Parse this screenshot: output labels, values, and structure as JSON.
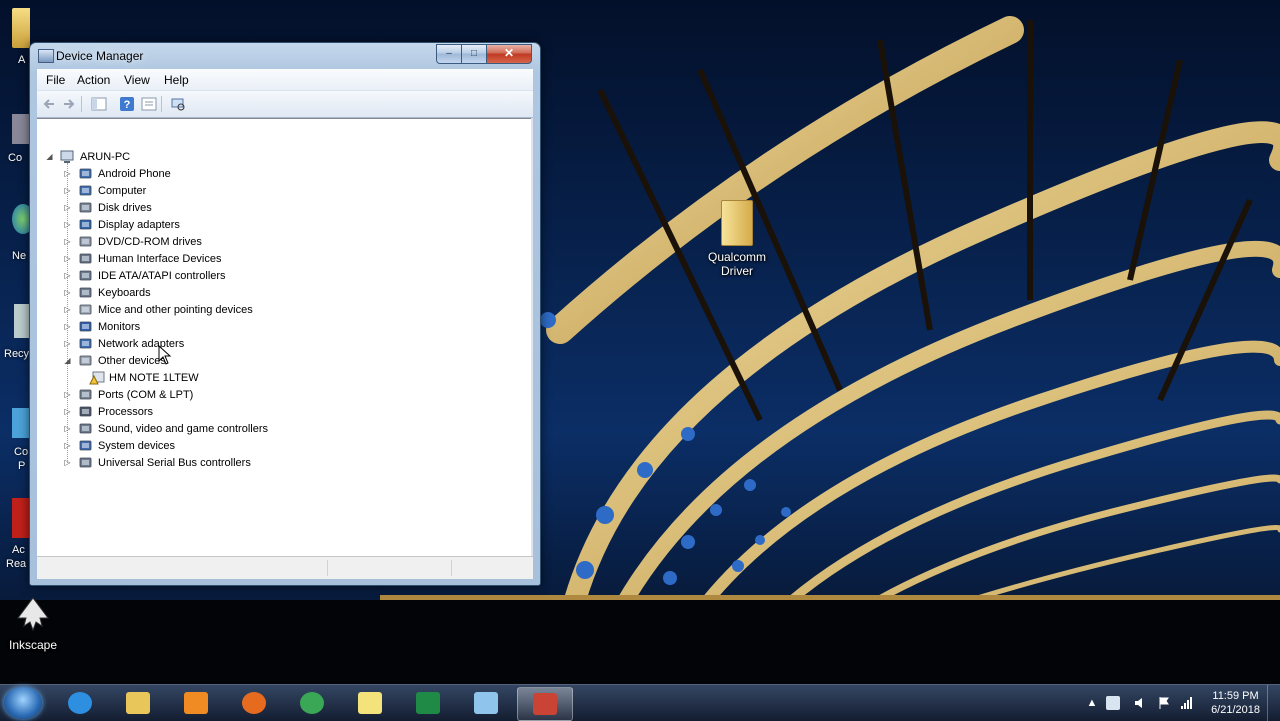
{
  "window": {
    "title": "Device Manager",
    "controls": {
      "minimize": "–",
      "maximize": "□",
      "close": "✕"
    }
  },
  "menu": {
    "file": "File",
    "action": "Action",
    "view": "View",
    "help": "Help"
  },
  "toolbar": {
    "icons": [
      "back-arrow-icon",
      "forward-arrow-icon",
      "show-hide-console-tree-icon",
      "help-icon",
      "properties-icon",
      "scan-hardware-icon"
    ]
  },
  "tree": {
    "root": "ARUN-PC",
    "items": [
      {
        "label": "Android Phone",
        "icon": "android-device-icon"
      },
      {
        "label": "Computer",
        "icon": "computer-icon"
      },
      {
        "label": "Disk drives",
        "icon": "disk-drive-icon"
      },
      {
        "label": "Display adapters",
        "icon": "display-adapter-icon"
      },
      {
        "label": "DVD/CD-ROM drives",
        "icon": "dvd-drive-icon"
      },
      {
        "label": "Human Interface Devices",
        "icon": "hid-icon"
      },
      {
        "label": "IDE ATA/ATAPI controllers",
        "icon": "ide-controller-icon"
      },
      {
        "label": "Keyboards",
        "icon": "keyboard-icon"
      },
      {
        "label": "Mice and other pointing devices",
        "icon": "mouse-icon"
      },
      {
        "label": "Monitors",
        "icon": "monitor-icon"
      },
      {
        "label": "Network adapters",
        "icon": "network-adapter-icon"
      },
      {
        "label": "Other devices",
        "icon": "other-devices-icon",
        "expanded": true
      },
      {
        "label": "HM NOTE 1LTEW",
        "icon": "warning-device-icon",
        "child": true
      },
      {
        "label": "Ports (COM & LPT)",
        "icon": "port-icon"
      },
      {
        "label": "Processors",
        "icon": "processor-icon"
      },
      {
        "label": "Sound, video and game controllers",
        "icon": "sound-icon"
      },
      {
        "label": "System devices",
        "icon": "system-device-icon"
      },
      {
        "label": "Universal Serial Bus controllers",
        "icon": "usb-icon"
      }
    ]
  },
  "desktop": {
    "qualcomm_folder": {
      "line1": "Qualcomm",
      "line2": "Driver"
    },
    "inkscape": "Inkscape",
    "left_strip_labels": [
      "A",
      "Co",
      "Ne",
      "Recy",
      "Co",
      "P",
      "Ac",
      "Rea"
    ]
  },
  "taskbar": {
    "apps": [
      "internet-explorer-icon",
      "file-explorer-icon",
      "media-player-icon",
      "firefox-icon",
      "chrome-icon",
      "sticky-notes-icon",
      "excel-icon",
      "notepad-icon",
      "device-manager-taskbar-icon"
    ],
    "active_app": "device-manager-taskbar-icon",
    "time": "11:59 PM",
    "date": "6/21/2018",
    "tray_expand": "▲"
  },
  "colors": {
    "accent": "#1f5fa8",
    "window_frame": "#a7c0dc",
    "warning": "#f3c13a"
  }
}
